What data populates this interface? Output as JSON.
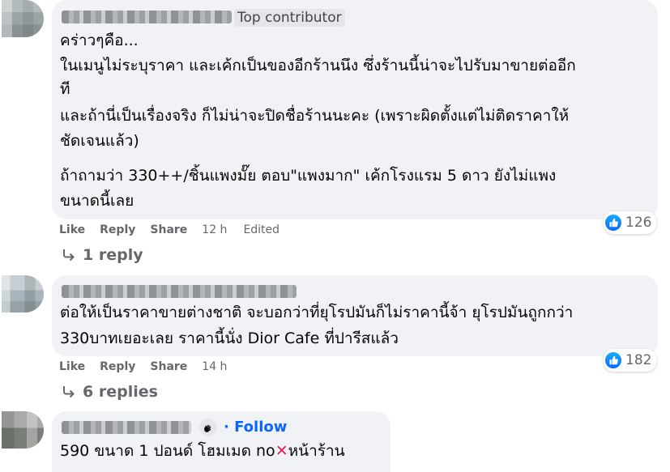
{
  "comments": [
    {
      "badge": "Top contributor",
      "lines": [
        "คร่าวๆคือ...",
        "ในเมนูไม่ระบุราคา และเค้กเป็นของอีกร้านนึง ซึ่งร้านนี้น่าจะไปรับมาขายต่ออีก",
        "ที",
        "และถ้านี่เป็นเรื่องจริง ก็ไม่น่าจะปิดชื่อร้านนะคะ (เพราะผิดตั้งแต่ไม่ติดราคาให้",
        "ชัดเจนแล้ว)",
        "ถ้าถามว่า 330++/ชิ้นแพงมั๊ย ตอบ\"แพงมาก\" เค้กโรงแรม 5 ดาว ยังไม่แพง",
        "ขนาดนี้เลย"
      ],
      "actions": {
        "like": "Like",
        "reply": "Reply",
        "share": "Share",
        "time": "12 h",
        "edited": "Edited"
      },
      "reaction_count": "126",
      "replies": "1 reply"
    },
    {
      "lines": [
        "ต่อให้เป็นราคาขายต่างชาติ จะบอกว่าที่ยุโรปมันก็ไม่ราคานี้จ้า ยุโรปมันถูกกว่า",
        "330บาทเยอะเลย ราคานี้นั่ง Dior Cafe ที่ปารีสแล้ว"
      ],
      "actions": {
        "like": "Like",
        "reply": "Reply",
        "share": "Share",
        "time": "14 h"
      },
      "reaction_count": "182",
      "replies": "6 replies"
    },
    {
      "follow": "· Follow",
      "line_before_x": "590 ขนาด 1 ปอนด์ โฮมเมด no",
      "line_after_x": "หน้าร้าน",
      "x_glyph": "✕"
    }
  ],
  "colors": {
    "bubble": "#f0f2f5",
    "link": "#0866ff",
    "meta": "#65676b",
    "cross": "#e0245e"
  }
}
